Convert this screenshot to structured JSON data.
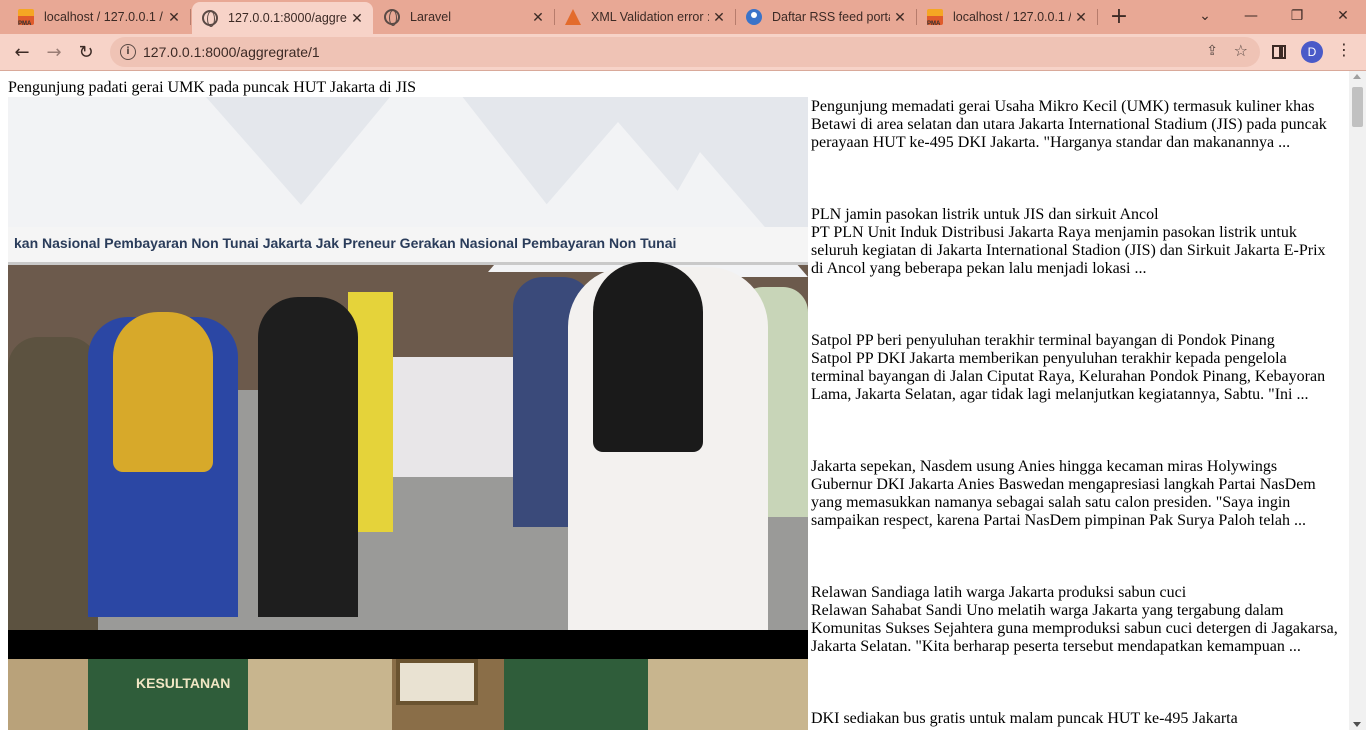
{
  "browser": {
    "tabs": [
      {
        "title": "localhost / 127.0.0.1 /",
        "icon": "pma-icon",
        "active": false
      },
      {
        "title": "127.0.0.1:8000/aggreg",
        "icon": "globe-icon",
        "active": true
      },
      {
        "title": "Laravel",
        "icon": "globe-icon",
        "active": false
      },
      {
        "title": "XML Validation error :",
        "icon": "xml-icon",
        "active": false
      },
      {
        "title": "Daftar RSS feed porta",
        "icon": "rss-icon",
        "active": false
      },
      {
        "title": "localhost / 127.0.0.1 /",
        "icon": "pma-icon",
        "active": false
      }
    ],
    "address": "127.0.0.1:8000/aggregrate/1",
    "profile_initial": "D"
  },
  "page": {
    "heading": "Pengunjung padati gerai UMK pada puncak HUT Jakarta di JIS",
    "photo1_banner_text": "kan Nasional Pembayaran Non Tunai   Jakarta   Jak Preneur   Gerakan Nasional Pembayaran Non Tunai",
    "photo2_label": "KESULTANAN",
    "items": [
      {
        "headline": "",
        "summary": "Pengunjung memadati gerai Usaha Mikro Kecil (UMK) termasuk kuliner khas Betawi di area selatan dan utara Jakarta International Stadium (JIS) pada puncak perayaan HUT ke-495 DKI Jakarta. \"Harganya standar dan makanannya ..."
      },
      {
        "headline": "PLN jamin pasokan listrik untuk JIS dan sirkuit Ancol",
        "summary": "PT PLN Unit Induk Distribusi Jakarta Raya menjamin pasokan listrik untuk seluruh kegiatan di Jakarta International Stadion (JIS) dan Sirkuit Jakarta E-Prix di Ancol yang beberapa pekan lalu menjadi lokasi ..."
      },
      {
        "headline": "Satpol PP beri penyuluhan terakhir terminal bayangan di Pondok Pinang",
        "summary": "Satpol PP DKI Jakarta memberikan penyuluhan terakhir kepada pengelola terminal bayangan di Jalan Ciputat Raya, Kelurahan Pondok Pinang, Kebayoran Lama, Jakarta Selatan, agar tidak lagi melanjutkan kegiatannya, Sabtu. \"Ini ..."
      },
      {
        "headline": "Jakarta sepekan, Nasdem usung Anies hingga kecaman miras Holywings",
        "summary": "Gubernur DKI Jakarta Anies Baswedan mengapresiasi langkah Partai NasDem yang memasukkan namanya sebagai salah satu calon presiden. \"Saya ingin sampaikan respect, karena Partai NasDem pimpinan Pak Surya Paloh telah ..."
      },
      {
        "headline": "Relawan Sandiaga latih warga Jakarta produksi sabun cuci",
        "summary": "Relawan Sahabat Sandi Uno melatih warga Jakarta yang tergabung dalam Komunitas Sukses Sejahtera guna memproduksi sabun cuci detergen di Jagakarsa, Jakarta Selatan. \"Kita berharap peserta tersebut mendapatkan kemampuan ..."
      },
      {
        "headline": "DKI sediakan bus gratis untuk malam puncak HUT ke-495 Jakarta",
        "summary": ""
      }
    ]
  }
}
